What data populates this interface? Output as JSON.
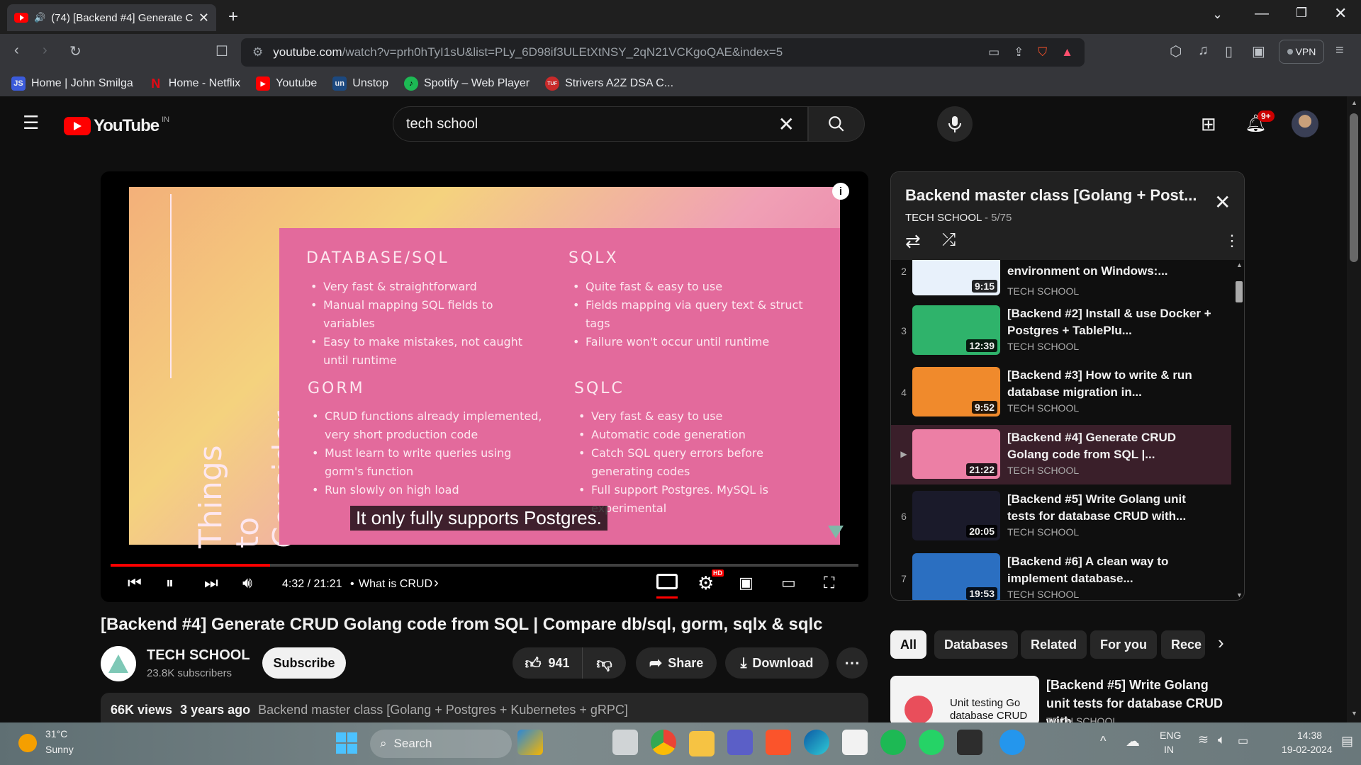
{
  "browser": {
    "tab_title": "(74) [Backend #4] Generate C",
    "url_host": "youtube.com",
    "url_path": "/watch?v=prh0hTyI1sU&list=PLy_6D98if3ULEtXtNSY_2qN21VCKgoQAE&index=5",
    "vpn_label": "VPN",
    "bookmarks": [
      {
        "label": "Home | John Smilga",
        "icon": "JS",
        "color": "#3b5bdb"
      },
      {
        "label": "Home - Netflix",
        "icon": "N",
        "color": "#e50914"
      },
      {
        "label": "Youtube",
        "icon": "▶",
        "color": "#ff0000"
      },
      {
        "label": "Unstop",
        "icon": "un",
        "color": "#1c4980"
      },
      {
        "label": "Spotify – Web Player",
        "icon": "♪",
        "color": "#1db954"
      },
      {
        "label": "Strivers A2Z DSA C...",
        "icon": "TUF",
        "color": "#c92a2a"
      }
    ]
  },
  "youtube": {
    "logo_text": "YouTube",
    "region": "IN",
    "search_value": "tech school",
    "notif_count": "9+"
  },
  "video": {
    "slide": {
      "col1_head": "DATABASE/SQL",
      "col1_items": [
        "Very fast & straightforward",
        "Manual mapping SQL fields to variables",
        "Easy to make mistakes, not caught until runtime"
      ],
      "col2_head": "SQLX",
      "col2_items": [
        "Quite fast & easy to use",
        "Fields mapping via query text & struct tags",
        "Failure won't occur until runtime"
      ],
      "col3_head": "GORM",
      "col3_items": [
        "CRUD functions already implemented, very short production code",
        "Must learn to write queries using gorm's function",
        "Run slowly on high load"
      ],
      "col4_head": "SQLC",
      "col4_items": [
        "Very fast & easy to use",
        "Automatic code generation",
        "Catch SQL query errors before generating codes",
        "Full support Postgres. MySQL is experimental"
      ],
      "vertical_line1": "Things to",
      "vertical_line2": "Consider"
    },
    "caption": "It only fully supports Postgres.",
    "time": "4:32 / 21:21",
    "chapter": "What is CRUD",
    "progress": 0.213,
    "title": "[Backend #4] Generate CRUD Golang code from SQL | Compare db/sql, gorm, sqlx & sqlc",
    "channel": "TECH SCHOOL",
    "subscribers": "23.8K subscribers",
    "subscribe_label": "Subscribe",
    "likes": "941",
    "share_label": "Share",
    "download_label": "Download",
    "views": "66K views",
    "age": "3 years ago",
    "playlist_link": "Backend master class [Golang + Postgres + Kubernetes + gRPC]"
  },
  "playlist": {
    "title": "Backend master class [Golang + Post...",
    "channel": "TECH SCHOOL",
    "position": "5/75",
    "items": [
      {
        "num": "2",
        "title": "environment on Windows:...",
        "channel": "TECH SCHOOL",
        "duration": "9:15",
        "color": "#e8f1fb"
      },
      {
        "num": "3",
        "title": "[Backend #2] Install & use Docker + Postgres + TablePlu...",
        "channel": "TECH SCHOOL",
        "duration": "12:39",
        "color": "#2fb36b"
      },
      {
        "num": "4",
        "title": "[Backend #3] How to write & run database migration in...",
        "channel": "TECH SCHOOL",
        "duration": "9:52",
        "color": "#f08a2c"
      },
      {
        "num": "▶",
        "title": "[Backend #4] Generate CRUD Golang code from SQL |...",
        "channel": "TECH SCHOOL",
        "duration": "21:22",
        "color": "#ec7fa5"
      },
      {
        "num": "6",
        "title": "[Backend #5] Write Golang unit tests for database CRUD with...",
        "channel": "TECH SCHOOL",
        "duration": "20:05",
        "color": "#1a1a2a"
      },
      {
        "num": "7",
        "title": "[Backend #6] A clean way to implement database...",
        "channel": "TECH SCHOOL",
        "duration": "19:53",
        "color": "#2b6fc1"
      }
    ]
  },
  "chips": [
    "All",
    "Databases",
    "Related",
    "For you",
    "Rece"
  ],
  "recommended": {
    "title": "[Backend #5] Write Golang unit tests for database CRUD with...",
    "channel": "TECH SCHOOL",
    "thumb_text": "Unit testing Go database CRUD"
  },
  "taskbar": {
    "temp": "31°C",
    "weather": "Sunny",
    "search_label": "Search",
    "lang1": "ENG",
    "lang2": "IN",
    "time": "14:38",
    "date": "19-02-2024"
  }
}
